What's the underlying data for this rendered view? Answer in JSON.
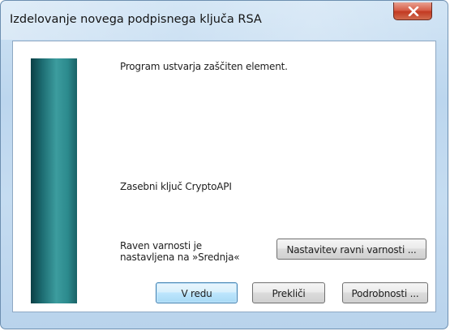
{
  "window": {
    "title": "Izdelovanje novega podpisnega ključa RSA",
    "close_icon": "close-icon"
  },
  "content": {
    "status_text": "Program ustvarja zaščiten element.",
    "key_name": "Zasebni ključ CryptoAPI",
    "security_level_line1": "Raven varnosti je",
    "security_level_line2": "nastavljena na »Srednja«"
  },
  "buttons": {
    "security_label": "Nastavitev ravni varnosti ...",
    "ok_label": "V redu",
    "cancel_label": "Prekliči",
    "details_label": "Podrobnosti ..."
  },
  "colors": {
    "close_button": "#c23a22",
    "banner": "#2c8a8d",
    "default_button_border": "#3c7fb1"
  }
}
